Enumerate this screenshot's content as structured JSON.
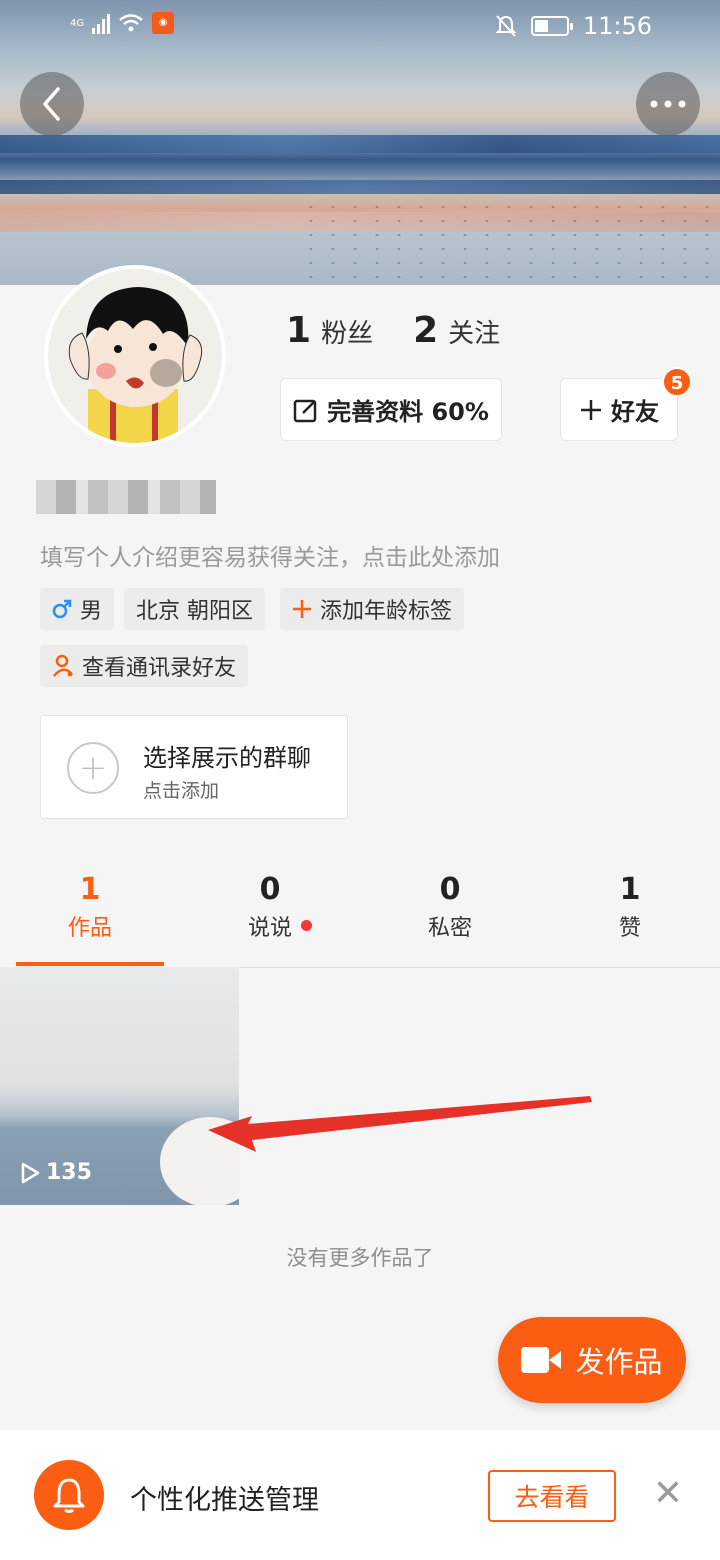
{
  "status_bar": {
    "network": "4G",
    "time": "11:56"
  },
  "header": {
    "back_icon": "chevron-left-icon",
    "more_icon": "more-dots-icon"
  },
  "profile": {
    "fans_count": "1",
    "fans_label": "粉丝",
    "follow_count": "2",
    "follow_label": "关注",
    "edit_profile_label": "完善资料 60%",
    "add_friend_label": "好友",
    "friend_badge": "5",
    "intro_placeholder": "填写个人介绍更容易获得关注，点击此处添加",
    "tags": {
      "gender": "男",
      "location": "北京 朝阳区",
      "age": "添加年龄标签",
      "contacts": "查看通讯录好友"
    },
    "group_card": {
      "title": "选择展示的群聊",
      "subtitle": "点击添加"
    }
  },
  "tabs": [
    {
      "count": "1",
      "label": "作品",
      "active": true
    },
    {
      "count": "0",
      "label": "说说",
      "active": false
    },
    {
      "count": "0",
      "label": "私密",
      "active": false
    },
    {
      "count": "1",
      "label": "赞",
      "active": false
    }
  ],
  "works": {
    "play_count": "135",
    "no_more_text": "没有更多作品了"
  },
  "publish_button": {
    "label": "发作品"
  },
  "push_bar": {
    "title": "个性化推送管理",
    "action": "去看看"
  },
  "colors": {
    "accent": "#fb5d13",
    "red_dot": "#f3382d",
    "male_blue": "#2b8ef3"
  }
}
